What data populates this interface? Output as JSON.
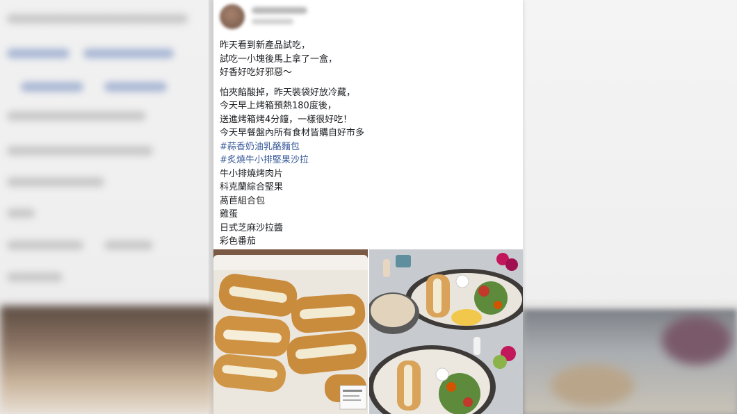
{
  "post": {
    "lines_block1": [
      "昨天看到新產品試吃，",
      "試吃一小塊後馬上拿了一盒，",
      "好香好吃好邪惡～"
    ],
    "lines_block2": [
      "怕夾餡酸掉，昨天裝袋好放冷藏，",
      "今天早上烤箱預熱180度後，",
      "送進烤箱烤4分鐘，一樣很好吃！",
      "今天早餐盤內所有食材皆購自好市多"
    ],
    "hashtags": [
      "#蒜香奶油乳酪麵包",
      "#炙燒牛小排堅果沙拉"
    ],
    "ingredients": [
      "牛小排燒烤肉片",
      "科克蘭綜合堅果",
      "萵苣組合包",
      "雞蛋",
      "日式芝麻沙拉醬",
      "彩色番茄"
    ]
  },
  "colors": {
    "text": "#1c1e21",
    "hashtag": "#365899",
    "card": "#ffffff"
  },
  "icons": {
    "left_photo": "garlic-cream-cheese-bread-box",
    "right_photo": "breakfast-plates-salad"
  }
}
